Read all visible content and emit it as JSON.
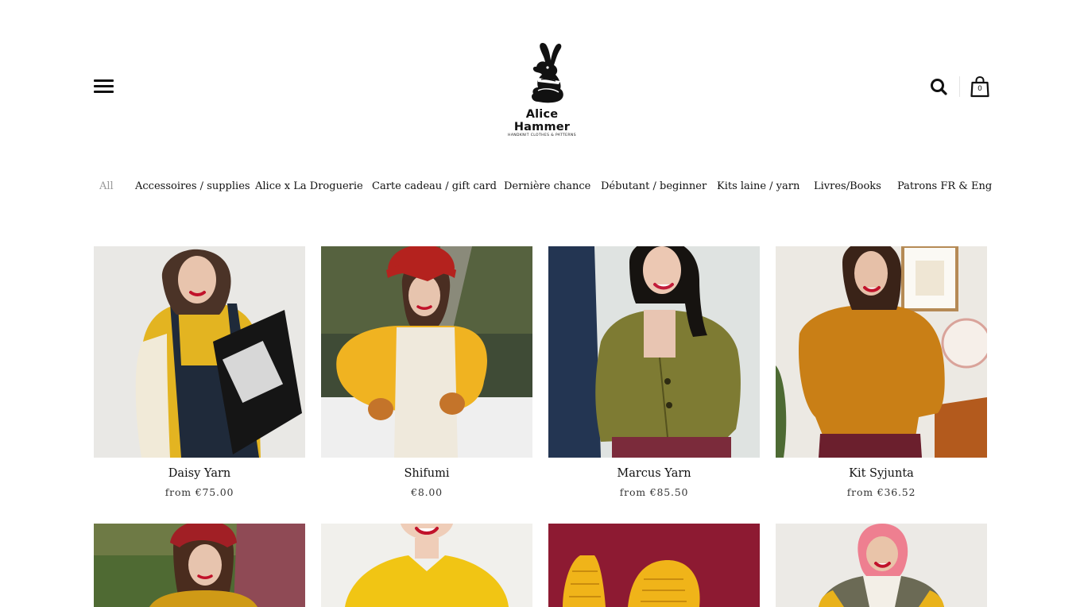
{
  "brand": {
    "name": "Alice Hammer",
    "tagline": "HANDKNIT CLOTHES & PATTERNS",
    "logo_icon": "rabbit-logo"
  },
  "header": {
    "menu_icon": "hamburger-menu-icon",
    "search_icon": "search-icon",
    "cart_icon": "shopping-bag-icon",
    "cart_count": "0"
  },
  "categories": [
    {
      "label": "All",
      "active": true
    },
    {
      "label": "Accessoires / supplies"
    },
    {
      "label": "Alice x La Droguerie"
    },
    {
      "label": "Carte cadeau / gift card"
    },
    {
      "label": "Dernière chance"
    },
    {
      "label": "Débutant / beginner"
    },
    {
      "label": "Kits laine / yarn"
    },
    {
      "label": "Livres/Books"
    },
    {
      "label": "Patrons FR & Eng"
    }
  ],
  "products": [
    {
      "name": "Daisy Yarn",
      "price": "from €75.00"
    },
    {
      "name": "Shifumi",
      "price": "€8.00"
    },
    {
      "name": "Marcus Yarn",
      "price": "from €85.50"
    },
    {
      "name": "Kit Syjunta",
      "price": "from €36.52"
    }
  ],
  "colors": {
    "text": "#111111",
    "muted": "#999999",
    "mustard": "#e0a81a",
    "olive": "#7d7a30",
    "rust": "#c98216",
    "burgundy": "#8e1a2e"
  }
}
